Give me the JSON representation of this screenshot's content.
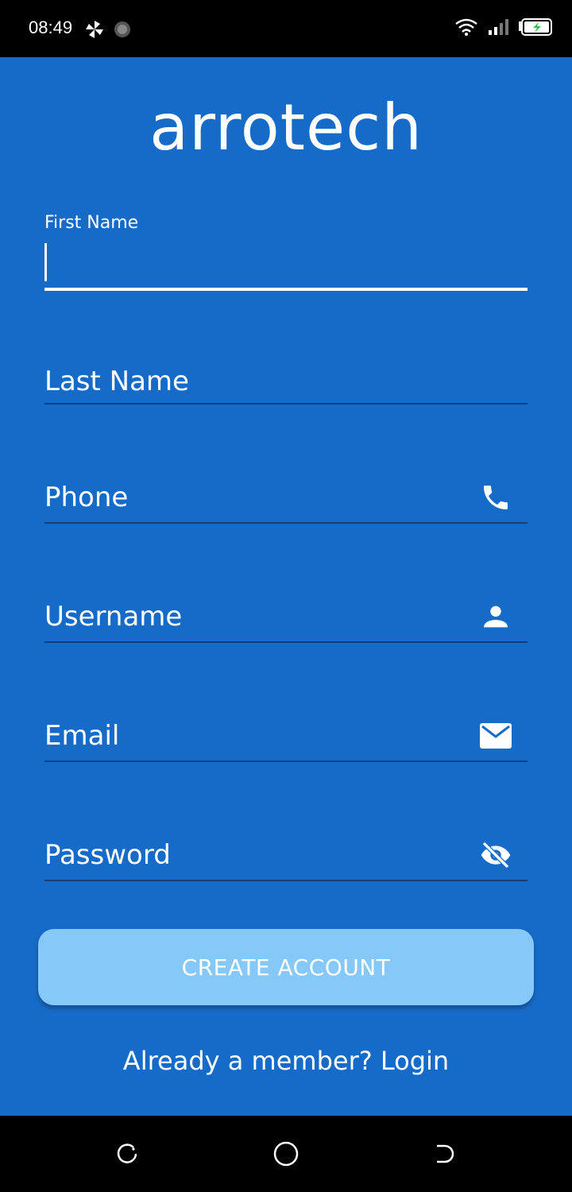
{
  "status_bar": {
    "time": "08:49",
    "icons": [
      "pinwheel-icon",
      "loading-icon",
      "wifi-icon",
      "signal-icon",
      "battery-charging-icon"
    ]
  },
  "app": {
    "brand": "arrotech",
    "background_color": "#176bc8"
  },
  "form": {
    "first_name": {
      "label": "First Name",
      "value": ""
    },
    "last_name": {
      "placeholder": "Last Name"
    },
    "phone": {
      "placeholder": "Phone",
      "icon": "phone-icon"
    },
    "username": {
      "placeholder": "Username",
      "icon": "person-icon"
    },
    "email": {
      "placeholder": "Email",
      "icon": "mail-icon"
    },
    "password": {
      "placeholder": "Password",
      "icon": "eye-off-icon"
    }
  },
  "actions": {
    "create_account": "CREATE ACCOUNT",
    "create_account_color": "#86c8f8",
    "login_prompt": "Already a member? Login"
  },
  "nav_bar": {
    "icons": [
      "recent-apps-icon",
      "home-icon",
      "back-icon"
    ]
  }
}
